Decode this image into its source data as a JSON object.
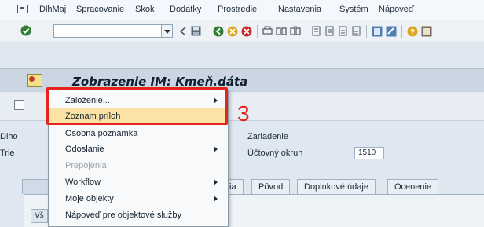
{
  "menubar": {
    "items": [
      "DlhMaj",
      "Spracovanie",
      "Skok",
      "Dodatky",
      "Prostredie",
      "Nastavenia",
      "Systém",
      "Nápoveď"
    ]
  },
  "toolbar": {
    "command_field_value": ""
  },
  "title": "Zobrazenie IM: Kmeň.dáta",
  "fields": {
    "dlho_label": "Dlho",
    "trie_label": "Trie",
    "zariadenie_label": "Zariadenie",
    "uctovny_okruh_label": "Účtovný okruh",
    "uctovny_okruh_value": "1510"
  },
  "tabs": [
    "ia",
    "Pôvod",
    "Doplnkové údaje",
    "Ocenenie"
  ],
  "panel_tab_label": "Vš",
  "context_menu": {
    "items": [
      {
        "label": "Založenie...",
        "submenu": true,
        "disabled": false,
        "highlighted": false
      },
      {
        "label": "Zoznam príloh",
        "submenu": false,
        "disabled": false,
        "highlighted": true
      },
      {
        "label": "Osobná poznámka",
        "submenu": false,
        "disabled": false,
        "highlighted": false
      },
      {
        "label": "Odoslanie",
        "submenu": true,
        "disabled": false,
        "highlighted": false
      },
      {
        "label": "Prepojenia",
        "submenu": false,
        "disabled": true,
        "highlighted": false
      },
      {
        "label": "Workflow",
        "submenu": true,
        "disabled": false,
        "highlighted": false
      },
      {
        "label": "Moje objekty",
        "submenu": true,
        "disabled": false,
        "highlighted": false
      },
      {
        "label": "Nápoveď pre objektové služby",
        "submenu": false,
        "disabled": false,
        "highlighted": false
      }
    ]
  },
  "annotation": {
    "step_number": "3",
    "color": "#e5241c"
  },
  "icons": {
    "toolbar": [
      "check-icon",
      "back-icon",
      "save-icon",
      "nav-back-icon",
      "exit-icon",
      "cancel-icon",
      "print-icon",
      "find-icon",
      "find-next-icon",
      "first-page-icon",
      "prev-page-icon",
      "next-page-icon",
      "last-page-icon",
      "new-session-icon",
      "shortcut-icon",
      "help-icon",
      "layout-icon"
    ]
  }
}
